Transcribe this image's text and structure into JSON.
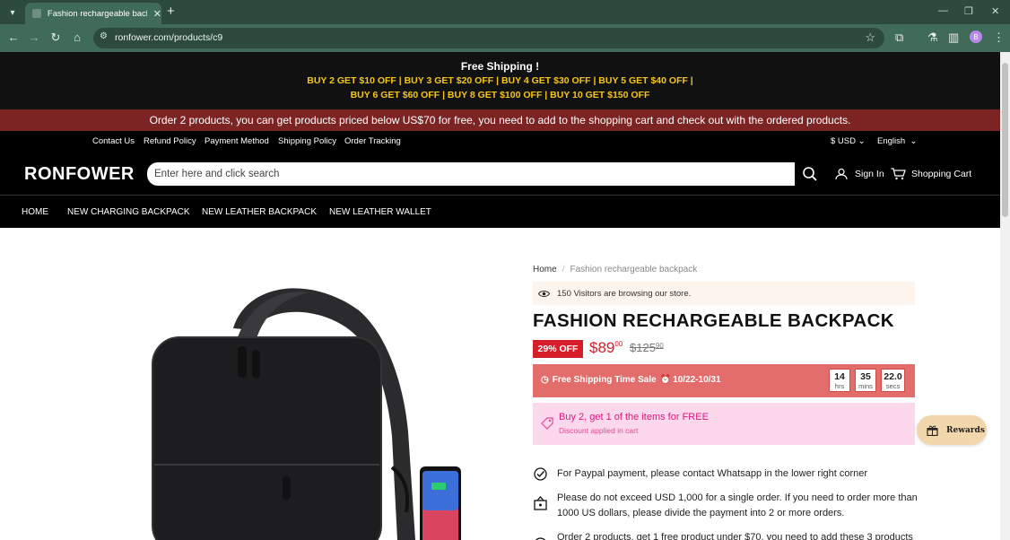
{
  "browser": {
    "tab_title": "Fashion rechargeable backpack",
    "url": "ronfower.com/products/c9",
    "profile_initial": "B"
  },
  "promo": {
    "headline": "Free Shipping !",
    "line1": "BUY 2 GET $10 OFF | BUY 3 GET $20 OFF | BUY 4 GET $30 OFF | BUY 5 GET $40 OFF |",
    "line2": "BUY 6 GET $60 OFF |  BUY 8 GET $100 OFF | BUY 10 GET $150 OFF",
    "colors": {
      "background": "#111111",
      "accent": "#f5c518"
    }
  },
  "notice": {
    "text": "Order 2 products, you can get products priced below US$70 for free, you need to add to the shopping cart and check out with the ordered products.",
    "color": "#7c2324"
  },
  "topnav": {
    "links": [
      "Contact Us",
      "Refund Policy",
      "Payment Method",
      "Shipping Policy",
      "Order Tracking"
    ],
    "currency": "$ USD",
    "language": "English"
  },
  "header": {
    "logo": "RONFOWER",
    "search_placeholder": "Enter here and click search",
    "sign_in": "Sign In",
    "cart": "Shopping Cart"
  },
  "mainnav": [
    "HOME",
    "NEW CHARGING BACKPACK",
    "NEW LEATHER BACKPACK",
    "NEW LEATHER WALLET"
  ],
  "breadcrumb": {
    "home": "Home",
    "current": "Fashion rechargeable backpack"
  },
  "visitors": "150 Visitors are browsing our store.",
  "product": {
    "title": "FASHION RECHARGEABLE BACKPACK",
    "discount_badge": "29% OFF",
    "price_main": "$89",
    "price_cents": "00",
    "old_price_main": "$125",
    "old_price_cents": "90",
    "price_color": "#d61e2a"
  },
  "sale": {
    "label": "Free Shipping Time Sale",
    "dates": "10/22-10/31",
    "countdown": [
      {
        "value": "14",
        "unit": "hrs"
      },
      {
        "value": "35",
        "unit": "mins"
      },
      {
        "value": "22.0",
        "unit": "secs"
      }
    ],
    "color": "#e36d6a"
  },
  "offer": {
    "headline": "Buy 2, get 1 of the items for FREE",
    "sub": "Discount applied in cart"
  },
  "rewards": "Rewards",
  "info": [
    {
      "icon": "check-circle-icon",
      "text": "For Paypal payment, please contact Whatsapp in the lower right corner"
    },
    {
      "icon": "lock-box-icon",
      "text": "Please do not exceed USD 1,000 for a single order. If you need to order more than 1000 US dollars, please divide the payment into 2 or more orders."
    },
    {
      "icon": "gift-icon",
      "text": "Order 2 products, get 1 free product under $70, you need to add these 3 products"
    }
  ]
}
